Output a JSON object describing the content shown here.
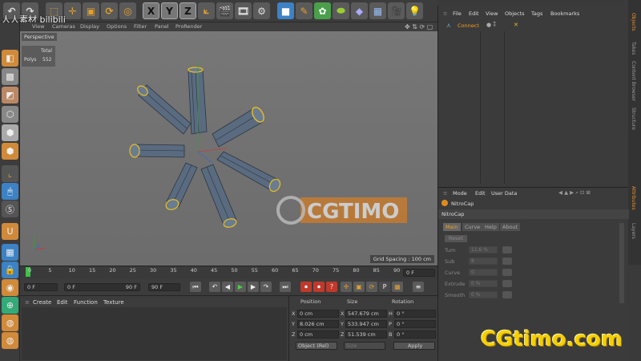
{
  "toolbar": {
    "axis_x": "X",
    "axis_y": "Y",
    "axis_z": "Z"
  },
  "viewport": {
    "menu": [
      "View",
      "Cameras",
      "Display",
      "Options",
      "Filter",
      "Panel",
      "ProRender"
    ],
    "label": "Perspective",
    "stats_total_label": "Total",
    "stats_polys_label": "Polys",
    "stats_polys_value": "552",
    "grid_spacing": "Grid Spacing : 100 cm"
  },
  "timeline": {
    "ticks": [
      "0",
      "5",
      "10",
      "15",
      "20",
      "25",
      "30",
      "35",
      "40",
      "45",
      "50",
      "55",
      "60",
      "65",
      "70",
      "75",
      "80",
      "85",
      "90"
    ],
    "current_frame_field": "0 F",
    "start_field": "0 F",
    "min_field": "0 F",
    "max_field": "90 F",
    "end_field": "90 F"
  },
  "material_manager": {
    "menu": [
      "Create",
      "Edit",
      "Function",
      "Texture"
    ]
  },
  "coordinates": {
    "headers": [
      "Position",
      "Size",
      "Rotation"
    ],
    "rows": [
      {
        "axis": "X",
        "pos": "0 cm",
        "size_axis": "X",
        "size": "547.679 cm",
        "rot_axis": "H",
        "rot": "0 °"
      },
      {
        "axis": "Y",
        "pos": "8.026 cm",
        "size_axis": "Y",
        "size": "533.947 cm",
        "rot_axis": "P",
        "rot": "0 °"
      },
      {
        "axis": "Z",
        "pos": "0 cm",
        "size_axis": "Z",
        "size": "51.539 cm",
        "rot_axis": "B",
        "rot": "0 °"
      }
    ],
    "mode_select": "Object (Rel)",
    "size_select": "Size",
    "apply_label": "Apply"
  },
  "objects": {
    "menu": [
      "File",
      "Edit",
      "View",
      "Objects",
      "Tags",
      "Bookmarks"
    ],
    "item": "Connect"
  },
  "right_tabs": [
    "Objects",
    "Takes",
    "Content Browser",
    "Structure",
    "Attributes",
    "Layers"
  ],
  "attributes": {
    "menu": [
      "Mode",
      "Edit",
      "User Data"
    ],
    "object_name": "NitroCap",
    "object_label": "NitroCap",
    "tabs": [
      "Main",
      "Curve",
      "Help",
      "About"
    ],
    "active_tab": "Main",
    "reset_label": "Reset",
    "params": [
      {
        "label": "Turn",
        "value": "11.6 %"
      },
      {
        "label": "Sub",
        "value": "8"
      },
      {
        "label": "Curve",
        "value": "0"
      },
      {
        "label": "Extrude",
        "value": "0 %"
      },
      {
        "label": "Smooth",
        "value": "0 %"
      }
    ]
  },
  "watermarks": {
    "logo": "CGtimo.com",
    "center": "CGTIMO",
    "top_left": "人人素材 bilibili"
  }
}
